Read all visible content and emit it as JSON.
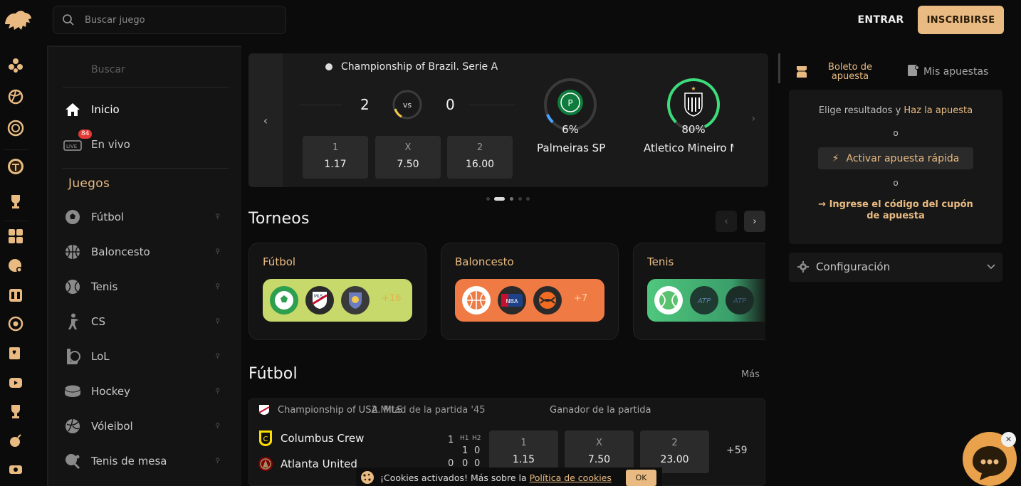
{
  "header": {
    "search_placeholder": "Buscar juego",
    "login_label": "ENTRAR",
    "signup_label": "INSCRIBIRSE"
  },
  "sidebar": {
    "search_label": "Buscar",
    "top_items": [
      {
        "label": "Inicio",
        "icon": "home-icon"
      },
      {
        "label": "En vivo",
        "icon": "live-icon",
        "badge": "84"
      }
    ],
    "games_heading": "Juegos",
    "games": [
      {
        "label": "Fútbol",
        "icon": "soccer-ball-icon"
      },
      {
        "label": "Baloncesto",
        "icon": "basketball-icon"
      },
      {
        "label": "Tenis",
        "icon": "tennis-ball-icon"
      },
      {
        "label": "CS",
        "icon": "soldier-icon"
      },
      {
        "label": "LoL",
        "icon": "lol-icon"
      },
      {
        "label": "Hockey",
        "icon": "hockey-puck-icon"
      },
      {
        "label": "Vóleibol",
        "icon": "volleyball-icon"
      },
      {
        "label": "Tenis de mesa",
        "icon": "table-tennis-icon"
      }
    ]
  },
  "banner": {
    "league": "Championship of Brazil. Serie A",
    "score_home": "2",
    "score_away": "0",
    "vs_label": "vs",
    "odds": [
      {
        "k": "1",
        "v": "1.17"
      },
      {
        "k": "X",
        "v": "7.50"
      },
      {
        "k": "2",
        "v": "16.00"
      }
    ],
    "home_team": {
      "name": "Palmeiras SP",
      "pct": "6%",
      "pct_value": 6,
      "ring_color": "#4aa3ff"
    },
    "away_team": {
      "name": "Atletico Mineiro MG",
      "pct": "80%",
      "pct_value": 80,
      "ring_color": "#3ddc7a"
    }
  },
  "torneos": {
    "title": "Torneos",
    "cards": [
      {
        "title": "Fútbol",
        "more": "+16",
        "pill_color": "#c6d96a"
      },
      {
        "title": "Baloncesto",
        "more": "+7",
        "pill_color": "#f07a44"
      },
      {
        "title": "Tenis",
        "more": "",
        "pill_color": "#4fc77d"
      }
    ]
  },
  "futbol": {
    "title": "Fútbol",
    "more_label": "Más",
    "match": {
      "league": "Championship of USA. MLS",
      "period": "2 Mitad de la partida '45",
      "market": "Ganador de la partida",
      "home": "Columbus Crew",
      "away": "Atlanta United",
      "h1_label": "H1",
      "h2_label": "H2",
      "home_score": "1",
      "home_h1": "1",
      "home_h2": "0",
      "away_score": "0",
      "away_h1": "0",
      "away_h2": "0",
      "odds": [
        {
          "k": "1",
          "v": "1.15"
        },
        {
          "k": "X",
          "v": "7.50"
        },
        {
          "k": "2",
          "v": "23.00"
        }
      ],
      "more": "+59"
    }
  },
  "right": {
    "tab_slip": "Boleto de apuesta",
    "tab_my_bets": "Mis apuestas",
    "slip_text": "Elige resultados y ",
    "slip_link": "Haz la apuesta",
    "or_label": "o",
    "quick_bet": "Activar apuesta rápida",
    "coupon": "→ Ingrese el código del cupón de apuesta",
    "config": "Configuración"
  },
  "cookie": {
    "text": "¡Cookies activados! Más sobre la ",
    "link": "Política de cookies",
    "ok": "OK"
  },
  "colors": {
    "accent": "#e9bb82",
    "bg": "#0b0b0b",
    "panel": "#141414"
  }
}
